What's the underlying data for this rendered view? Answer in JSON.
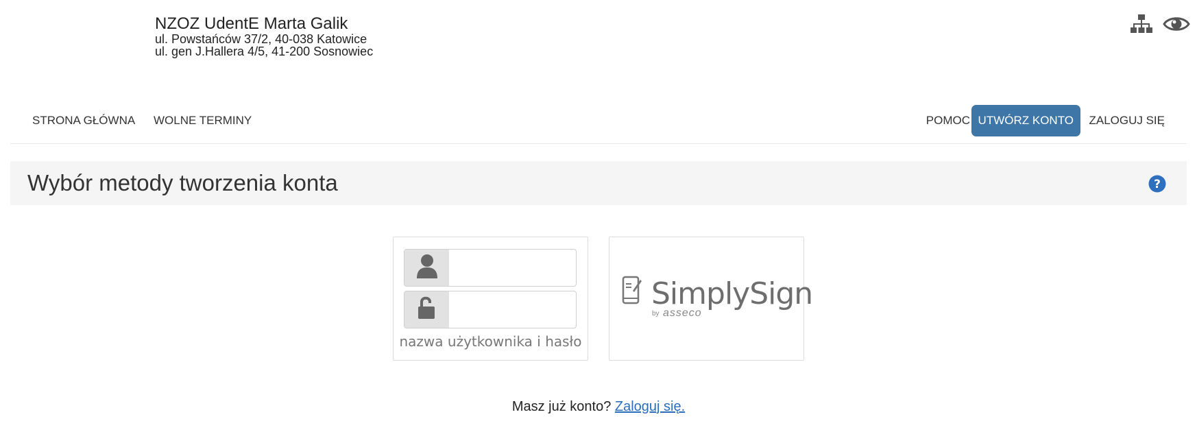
{
  "clinic": {
    "name": "NZOZ UdentE Marta Galik",
    "address1": "ul. Powstańców 37/2, 40-038 Katowice",
    "address2": "ul. gen J.Hallera 4/5, 41-200 Sosnowiec"
  },
  "top_icons": [
    "sitemap-icon",
    "eye-icon"
  ],
  "nav": {
    "left": [
      {
        "label": "STRONA GŁÓWNA"
      },
      {
        "label": "WOLNE TERMINY"
      }
    ],
    "right": [
      {
        "label": "POMOC"
      },
      {
        "label": "UTWÓRZ KONTO",
        "active": true
      },
      {
        "label": "ZALOGUJ SIĘ"
      }
    ]
  },
  "page": {
    "title": "Wybór metody tworzenia konta",
    "help_icon": "question-circle-icon"
  },
  "methods": [
    {
      "caption": "nazwa użytkownika i hasło",
      "icons": [
        "user-icon",
        "unlock-icon"
      ]
    },
    {
      "logo_text": "SimplySign",
      "logo_by": "by",
      "logo_brand": "asseco"
    }
  ],
  "footer": {
    "text": "Masz już konto?",
    "link": "Zaloguj się."
  },
  "colors": {
    "accent": "#3e76a8",
    "link": "#2a6ebb",
    "title_bar_bg": "#f5f5f5"
  }
}
